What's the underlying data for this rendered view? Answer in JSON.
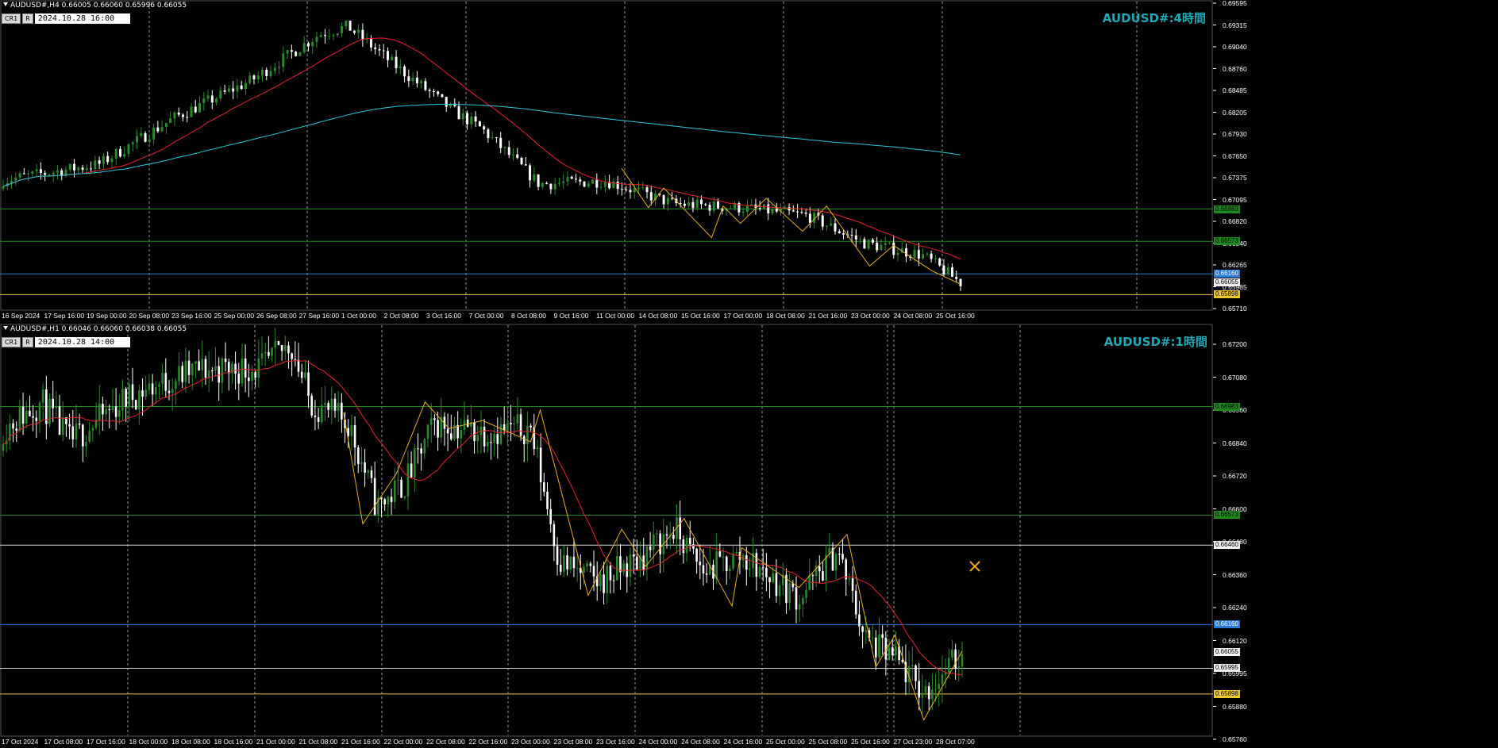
{
  "colors": {
    "bull": "#2b8a2b",
    "bear": "#ffffff",
    "ma_fast": "#e8222a",
    "ma_slow": "#2ac8d8",
    "zigzag": "#e8b020",
    "green_line": "#1e8a1e",
    "blue_line": "#2a7ad8",
    "white_line": "#d8d8d8",
    "yellow_line": "#e8c040",
    "wm": "#1fa8b8"
  },
  "top": {
    "header": "AUDUSD#,H4 0.66005 0.66060 0.65996 0.66055",
    "btn1": "CR1",
    "btn2": "R",
    "datetime": "2024.10.28 16:00",
    "watermark": "AUDUSD#:4時間",
    "price_ticks": [
      "0.69595",
      "0.69315",
      "0.69040",
      "0.68760",
      "0.68485",
      "0.68205",
      "0.67930",
      "0.67650",
      "0.67375",
      "0.67095",
      "0.66820",
      "0.66540",
      "0.66265",
      "0.65985",
      "0.65710"
    ],
    "labels": [
      {
        "text": "0.66983",
        "kind": "green",
        "price": 0.66983
      },
      {
        "text": "0.66573",
        "kind": "green",
        "price": 0.66573
      },
      {
        "text": "0.66160",
        "kind": "blue",
        "price": 0.6616
      },
      {
        "text": "0.66055",
        "kind": "white",
        "price": 0.66055
      },
      {
        "text": "0.65898",
        "kind": "yellow",
        "price": 0.65898
      }
    ],
    "x_labels": [
      "16 Sep 2024",
      "17 Sep 16:00",
      "19 Sep 00:00",
      "20 Sep 08:00",
      "23 Sep 16:00",
      "25 Sep 00:00",
      "26 Sep 08:00",
      "27 Sep 16:00",
      "1 Oct 00:00",
      "2 Oct 08:00",
      "3 Oct 16:00",
      "7 Oct 00:00",
      "8 Oct 08:00",
      "9 Oct 16:00",
      "11 Oct 00:00",
      "14 Oct 08:00",
      "15 Oct 16:00",
      "17 Oct 00:00",
      "18 Oct 08:00",
      "21 Oct 16:00",
      "23 Oct 00:00",
      "24 Oct 08:00",
      "25 Oct 16:00"
    ]
  },
  "bottom": {
    "header": "AUDUSD#,H1 0.66046 0.66060 0.66038 0.66055",
    "btn1": "CR1",
    "btn2": "R",
    "datetime": "2024.10.28 14:00",
    "watermark": "AUDUSD#:1時間",
    "price_ticks": [
      "0.67200",
      "0.67080",
      "0.66960",
      "0.66840",
      "0.66720",
      "0.66600",
      "0.66480",
      "0.66360",
      "0.66240",
      "0.66120",
      "0.65995",
      "0.65880",
      "0.65760"
    ],
    "labels": [
      {
        "text": "0.66983",
        "kind": "green",
        "price": 0.66983
      },
      {
        "text": "0.66573",
        "kind": "green",
        "price": 0.66573
      },
      {
        "text": "0.66460",
        "kind": "white",
        "price": 0.6646
      },
      {
        "text": "0.66160",
        "kind": "blue",
        "price": 0.6616
      },
      {
        "text": "0.66055",
        "kind": "white",
        "price": 0.66055
      },
      {
        "text": "0.65995",
        "kind": "white",
        "price": 0.65995
      },
      {
        "text": "0.65898",
        "kind": "yellow",
        "price": 0.65898
      }
    ],
    "x_labels": [
      "17 Oct 2024",
      "17 Oct 08:00",
      "17 Oct 16:00",
      "18 Oct 00:00",
      "18 Oct 08:00",
      "18 Oct 16:00",
      "21 Oct 00:00",
      "21 Oct 08:00",
      "21 Oct 16:00",
      "22 Oct 00:00",
      "22 Oct 08:00",
      "22 Oct 16:00",
      "23 Oct 00:00",
      "23 Oct 08:00",
      "23 Oct 16:00",
      "24 Oct 00:00",
      "24 Oct 08:00",
      "24 Oct 16:00",
      "25 Oct 00:00",
      "25 Oct 08:00",
      "25 Oct 16:00",
      "27 Oct 23:00",
      "28 Oct 07:00"
    ]
  }
}
